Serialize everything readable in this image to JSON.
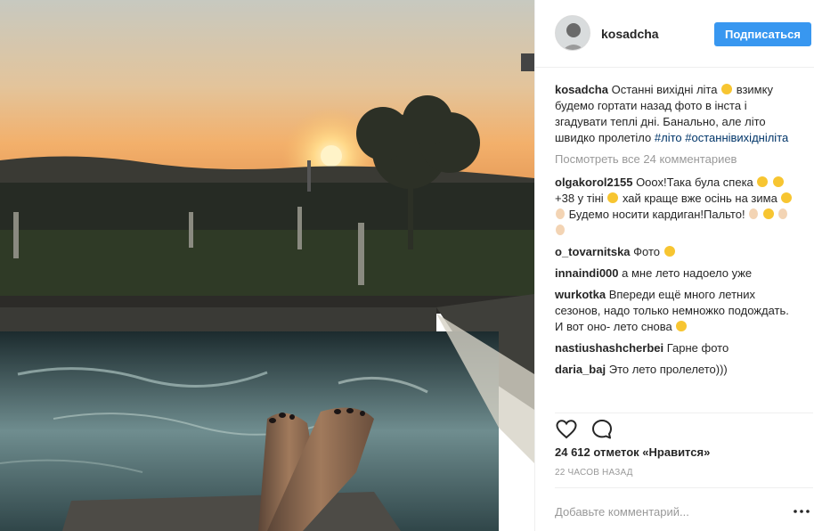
{
  "post": {
    "username": "kosadcha",
    "follow_label": "Подписаться",
    "caption_user": "kosadcha",
    "caption_text": "Останні вихідні літа",
    "caption_text2": "взимку будемо гортати назад фото в інста і згадувати теплі дні. Банально, але літо швидко пролетіло",
    "hashtag1": "#літо",
    "hashtag2": "#останнівихідніліта",
    "view_all_comments": "Посмотреть все 24 комментариев",
    "likes": "24 612 отметок «Нравится»",
    "time_ago": "22 ЧАСОВ НАЗАД",
    "add_comment_placeholder": "Добавьте комментарий..."
  },
  "comments": [
    {
      "user": "olgakorol2155",
      "text1": "Ооох!Така була спека",
      "text2": "+38 у тіні",
      "text3": "хай краще вже осінь на зима",
      "text4": "Будемо носити кардиган!Пальто!"
    },
    {
      "user": "o_tovarnitska",
      "text1": "Фото"
    },
    {
      "user": "innaindi000",
      "text1": "а мне лето надоело уже"
    },
    {
      "user": "wurkotka",
      "text1": "Впереди ещё много летних сезонов, надо только немножко подождать. И вот оно- лето снова"
    },
    {
      "user": "nastiushashcherbei",
      "text1": "Гарне фото"
    },
    {
      "user": "daria_baj",
      "text1": "Это лето пролелето)))"
    }
  ],
  "icons": {
    "heart": "heart-icon",
    "comment": "comment-icon",
    "more": "more-options-icon"
  },
  "colors": {
    "accent": "#3897f0",
    "hashtag": "#003569",
    "muted": "#999999"
  }
}
